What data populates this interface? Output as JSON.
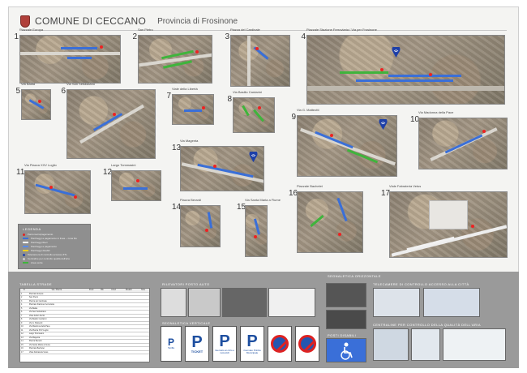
{
  "header": {
    "title": "COMUNE DI CECCANO",
    "subtitle": "Provincia di Frosinone"
  },
  "areas": [
    {
      "num": "1",
      "name": "Piazzale Europa"
    },
    {
      "num": "2",
      "name": "San Pietro"
    },
    {
      "num": "3",
      "name": "Piazza del Cardinale"
    },
    {
      "num": "4",
      "name": "Piazzale Stazione Ferroviaria / Via per Frosinone"
    },
    {
      "num": "5",
      "name": "Via Badia"
    },
    {
      "num": "6",
      "name": "Via San Sebastiano"
    },
    {
      "num": "7",
      "name": "Viale della Libertà"
    },
    {
      "num": "8",
      "name": "Via Basilio Cardarini"
    },
    {
      "num": "9",
      "name": "Via G. Matteotti"
    },
    {
      "num": "10",
      "name": "Via Madonna della Pace"
    },
    {
      "num": "11",
      "name": "Via Piazza XXV Luglio"
    },
    {
      "num": "12",
      "name": "Largo Tommasini"
    },
    {
      "num": "13",
      "name": "Via Magenta"
    },
    {
      "num": "14",
      "name": "Piazza Berardi"
    },
    {
      "num": "15",
      "name": "Via Santa Maria a Fiume"
    },
    {
      "num": "16",
      "name": "Piazzale Bachelet"
    },
    {
      "num": "17",
      "name": "Viale Fabrateria Vetus"
    }
  ],
  "legend": {
    "title": "LEGENDA",
    "items": [
      {
        "label": "Parcometro/pagamento",
        "color": "#e22222",
        "kind": "dot"
      },
      {
        "label": "Parcheggi a pagamento in linea – zona blu",
        "color": "#3a6fd8",
        "kind": "bar"
      },
      {
        "label": "Parcheggi liberi",
        "color": "#ffffff",
        "kind": "bar"
      },
      {
        "label": "Parcheggi a pagamento",
        "color": "#5a8be8",
        "kind": "bar"
      },
      {
        "label": "Parcheggi disabili",
        "color": "#f0d020",
        "kind": "bar"
      },
      {
        "label": "Telecamera di controllo accesso ZTL",
        "color": "#2244aa",
        "kind": "dot"
      },
      {
        "label": "Centraline per controllo qualità dell'aria",
        "color": "#cccccc",
        "kind": "dot"
      },
      {
        "label": "Area verde",
        "color": "#3fb43c",
        "kind": "bar"
      }
    ]
  },
  "bottom": {
    "table_title": "TABELLA STRADE",
    "rilevatori_title": "RILEVATORI POSTO AUTO",
    "segn_oriz_title": "SEGNALETICA ORIZZONTALE",
    "segn_vert_title": "SEGNALETICA VERTICALE",
    "posti_disabili_title": "POSTI DISABILI",
    "telecamere_title": "TELECAMERE DI CONTROLLO ACCESSO ALLA CITTÀ",
    "centraline_title": "CENTRALINE PER CONTROLLO DELLA QUALITÀ DELL'ARIA",
    "signs": [
      {
        "glyph": "P",
        "caption": "Tariffa"
      },
      {
        "glyph": "P",
        "caption": "TICKET"
      },
      {
        "glyph": "P",
        "caption": "riservato ai ciclo e motocicli"
      },
      {
        "glyph": "P",
        "caption": "riservato Polizia Municipale"
      }
    ]
  },
  "table": {
    "headers": [
      "N.",
      "Via / Piazza",
      "Posti",
      "Blu",
      "Liberi",
      "Disabili",
      "Note"
    ],
    "rows": [
      [
        "1",
        "Piazzale Europa",
        "",
        "",
        "",
        "",
        ""
      ],
      [
        "2",
        "San Pietro",
        "",
        "",
        "",
        "",
        ""
      ],
      [
        "3",
        "Piazza del Cardinale",
        "",
        "",
        "",
        "",
        ""
      ],
      [
        "4",
        "Piazzale Stazione Ferroviaria",
        "",
        "",
        "",
        "",
        ""
      ],
      [
        "5",
        "Via Badia",
        "",
        "",
        "",
        "",
        ""
      ],
      [
        "6",
        "Via San Sebastiano",
        "",
        "",
        "",
        "",
        ""
      ],
      [
        "7",
        "Viale della Libertà",
        "",
        "",
        "",
        "",
        ""
      ],
      [
        "8",
        "Via Basilio Cardarini",
        "",
        "",
        "",
        "",
        ""
      ],
      [
        "9",
        "Via G. Matteotti",
        "",
        "",
        "",
        "",
        ""
      ],
      [
        "10",
        "Via Madonna della Pace",
        "",
        "",
        "",
        "",
        ""
      ],
      [
        "11",
        "Via Piazza XXV Luglio",
        "",
        "",
        "",
        "",
        ""
      ],
      [
        "12",
        "Largo Tommasini",
        "",
        "",
        "",
        "",
        ""
      ],
      [
        "13",
        "Via Magenta",
        "",
        "",
        "",
        "",
        ""
      ],
      [
        "14",
        "Piazza Berardi",
        "",
        "",
        "",
        "",
        ""
      ],
      [
        "15",
        "Via Santa Maria a Fiume",
        "",
        "",
        "",
        "",
        ""
      ],
      [
        "16",
        "Piazzale Bachelet",
        "",
        "",
        "",
        "",
        ""
      ],
      [
        "17",
        "Viale Fabrateria Vetus",
        "",
        "",
        "",
        "",
        ""
      ]
    ]
  }
}
